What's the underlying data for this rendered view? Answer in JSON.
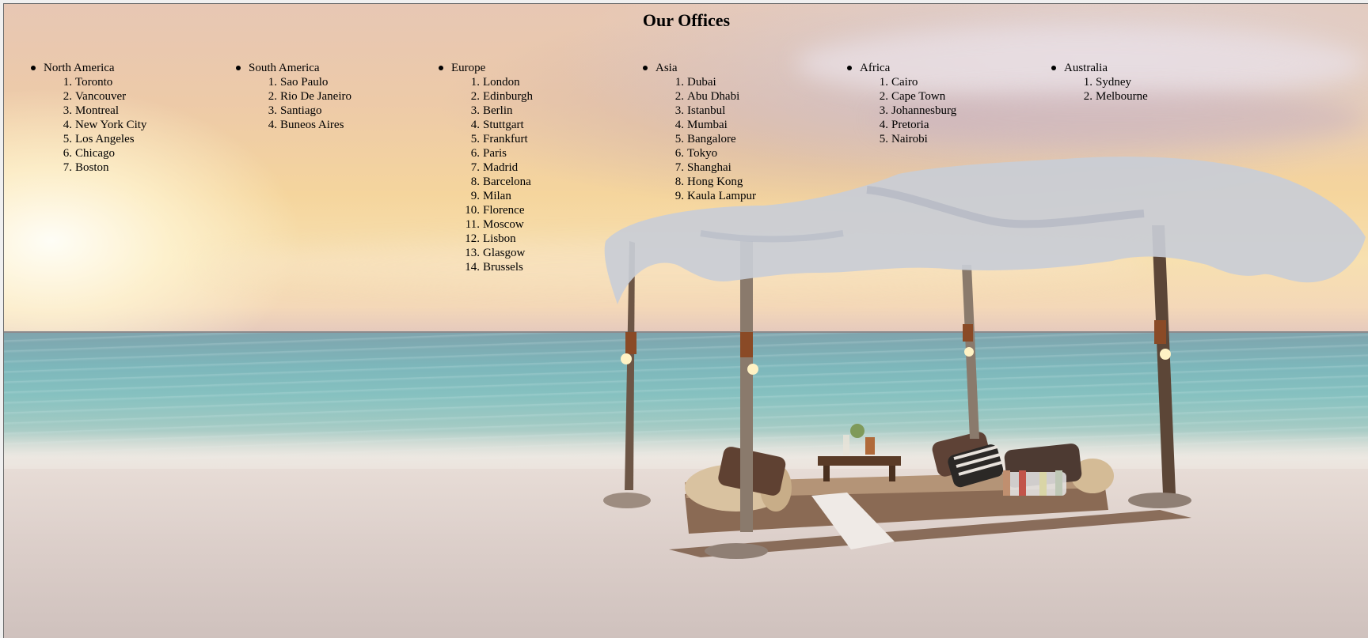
{
  "page": {
    "title": "Our Offices"
  },
  "colors": {
    "text": "#000000",
    "sky_top": "#e7c7b4",
    "sky_glow": "#f7e0b0",
    "sea": "#7db7bb",
    "sand": "#ddd0cb"
  },
  "regions": [
    {
      "name": "North America",
      "cities": [
        "Toronto",
        "Vancouver",
        "Montreal",
        "New York City",
        "Los Angeles",
        "Chicago",
        "Boston"
      ]
    },
    {
      "name": "South America",
      "cities": [
        "Sao Paulo",
        "Rio De Janeiro",
        "Santiago",
        "Buneos Aires"
      ]
    },
    {
      "name": "Europe",
      "cities": [
        "London",
        "Edinburgh",
        "Berlin",
        "Stuttgart",
        "Frankfurt",
        "Paris",
        "Madrid",
        "Barcelona",
        "Milan",
        "Florence",
        "Moscow",
        "Lisbon",
        "Glasgow",
        "Brussels"
      ]
    },
    {
      "name": "Asia",
      "cities": [
        "Dubai",
        "Abu Dhabi",
        "Istanbul",
        "Mumbai",
        "Bangalore",
        "Tokyo",
        "Shanghai",
        "Hong Kong",
        "Kaula Lampur"
      ]
    },
    {
      "name": "Africa",
      "cities": [
        "Cairo",
        "Cape Town",
        "Johannesburg",
        "Pretoria",
        "Nairobi"
      ]
    },
    {
      "name": "Australia",
      "cities": [
        "Sydney",
        "Melbourne"
      ]
    }
  ]
}
